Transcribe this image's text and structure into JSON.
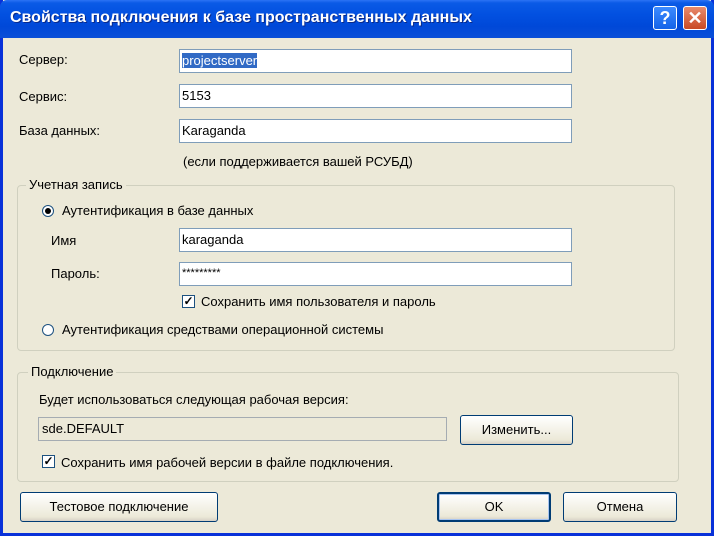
{
  "window": {
    "title": "Свойства подключения к базе пространственных данных"
  },
  "titlebar_buttons": {
    "help": "?",
    "close": "✕"
  },
  "server": {
    "label": "Сервер:",
    "value": "projectserver"
  },
  "service": {
    "label": "Сервис:",
    "value": "5153"
  },
  "database": {
    "label": "База данных:",
    "value": "Karaganda",
    "hint": "(если поддерживается вашей РСУБД)"
  },
  "account": {
    "legend": "Учетная запись",
    "db_auth_label": "Аутентификация в базе данных",
    "db_auth_selected": true,
    "username_label": "Имя",
    "username_value": "karaganda",
    "password_label": "Пароль:",
    "password_value": "*********",
    "save_credentials_label": "Сохранить имя пользователя и пароль",
    "save_credentials_checked": true,
    "os_auth_label": "Аутентификация средствами операционной системы",
    "os_auth_selected": false
  },
  "connection": {
    "legend": "Подключение",
    "version_text": "Будет использоваться следующая рабочая версия:",
    "version_value": "sde.DEFAULT",
    "change_button": "Изменить...",
    "save_version_label": "Сохранить имя рабочей версии в файле подключения.",
    "save_version_checked": true
  },
  "buttons": {
    "test": "Тестовое подключение",
    "ok": "OK",
    "cancel": "Отмена"
  }
}
